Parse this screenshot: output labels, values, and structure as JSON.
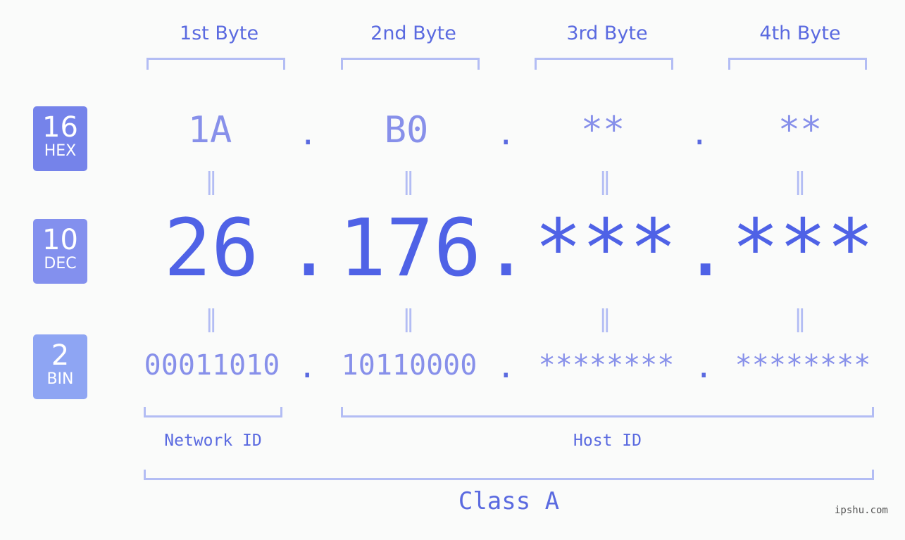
{
  "byte_headers": [
    "1st Byte",
    "2nd Byte",
    "3rd Byte",
    "4th Byte"
  ],
  "badges": [
    {
      "number": "16",
      "label": "HEX",
      "color": "#7583ea"
    },
    {
      "number": "10",
      "label": "DEC",
      "color": "#8390ee"
    },
    {
      "number": "2",
      "label": "BIN",
      "color": "#8ea5f3"
    }
  ],
  "hex": [
    "1A",
    "B0",
    "**",
    "**"
  ],
  "dec": [
    "26",
    "176",
    "***",
    "***"
  ],
  "bin": [
    "00011010",
    "10110000",
    "********",
    "********"
  ],
  "separator": ".",
  "equals": "=",
  "network_label": "Network ID",
  "host_label": "Host ID",
  "class_label": "Class A",
  "watermark": "ipshu.com"
}
